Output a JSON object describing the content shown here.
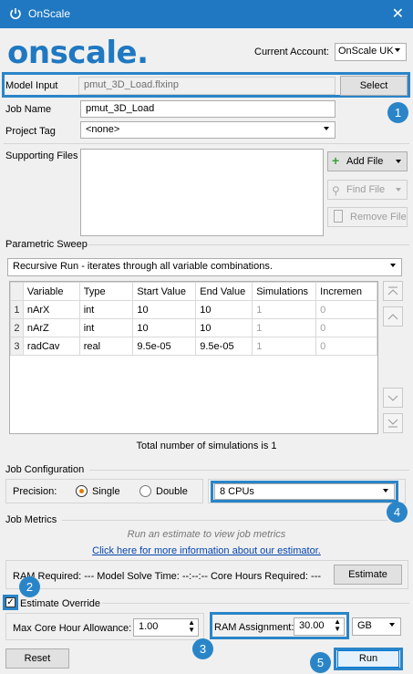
{
  "window": {
    "title": "OnScale"
  },
  "header": {
    "logo_text": "onscale.",
    "account_label": "Current Account:",
    "account_value": "OnScale UK"
  },
  "model_input": {
    "label": "Model Input",
    "value": "pmut_3D_Load.flxinp",
    "select_label": "Select"
  },
  "job_name": {
    "label": "Job Name",
    "value": "pmut_3D_Load"
  },
  "project_tag": {
    "label": "Project Tag",
    "value": "<none>"
  },
  "supporting_files": {
    "label": "Supporting Files",
    "add_label": "Add File",
    "find_label": "Find File",
    "remove_label": "Remove File"
  },
  "parametric_sweep": {
    "title": "Parametric Sweep",
    "mode": "Recursive Run  -  iterates through all variable combinations.",
    "columns": [
      "Variable",
      "Type",
      "Start Value",
      "End Value",
      "Simulations",
      "Incremen"
    ],
    "rows": [
      {
        "n": "1",
        "variable": "nArX",
        "type": "int",
        "start": "10",
        "end": "10",
        "sims": "1",
        "inc": "0"
      },
      {
        "n": "2",
        "variable": "nArZ",
        "type": "int",
        "start": "10",
        "end": "10",
        "sims": "1",
        "inc": "0"
      },
      {
        "n": "3",
        "variable": "radCav",
        "type": "real",
        "start": "9.5e-05",
        "end": "9.5e-05",
        "sims": "1",
        "inc": "0"
      }
    ],
    "total_text": "Total number of simulations is 1"
  },
  "job_config": {
    "title": "Job Configuration",
    "precision_label": "Precision:",
    "single_label": "Single",
    "double_label": "Double",
    "selected_precision": "Single",
    "cpus": "8 CPUs"
  },
  "job_metrics": {
    "title": "Job Metrics",
    "hint": "Run an estimate to view job metrics",
    "link": "Click here for more information about our estimator.",
    "summary": "RAM Required: --- Model Solve Time: --:--:-- Core Hours Required: ---",
    "estimate_label": "Estimate"
  },
  "estimate_override": {
    "label": "Estimate Override",
    "checked": true
  },
  "max_core": {
    "label": "Max Core Hour Allowance:",
    "value": "1.00"
  },
  "ram": {
    "label": "RAM Assignment:",
    "value": "30.00",
    "unit": "GB"
  },
  "footer": {
    "reset_label": "Reset",
    "run_label": "Run"
  },
  "callouts": [
    "1",
    "2",
    "3",
    "4",
    "5"
  ]
}
